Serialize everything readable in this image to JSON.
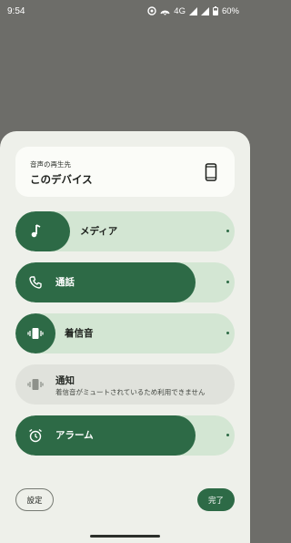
{
  "status_bar": {
    "time": "9:54",
    "network": "4G",
    "battery": "60%"
  },
  "output": {
    "caption": "音声の再生先",
    "device": "このデバイス",
    "icon": "phone-icon"
  },
  "sliders": [
    {
      "label": "メディア",
      "icon": "music-note-icon",
      "level": 0.25
    },
    {
      "label": "通話",
      "icon": "call-icon",
      "level": 0.82
    },
    {
      "label": "着信音",
      "icon": "vibrate-icon",
      "level": 0.18
    },
    {
      "label": "通知",
      "sub": "着信音がミュートされているため利用できません",
      "icon": "vibrate-icon",
      "disabled": true
    },
    {
      "label": "アラーム",
      "icon": "alarm-icon",
      "level": 0.82
    }
  ],
  "buttons": {
    "settings": "設定",
    "done": "完了"
  },
  "colors": {
    "accent": "#2d6a46",
    "track": "#d3e6d3",
    "sheet": "#eef0ea",
    "scrim": "#6d6d69"
  }
}
